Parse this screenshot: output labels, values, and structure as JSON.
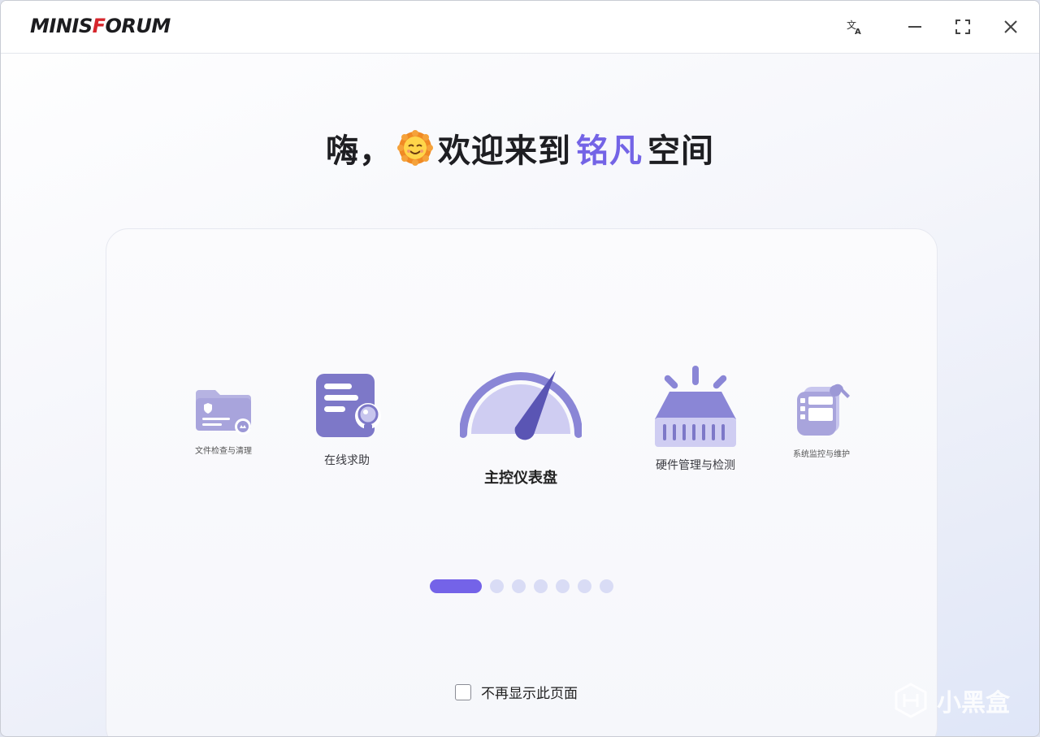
{
  "titlebar": {
    "logo_text_1": "MINIS",
    "logo_text_2": "F",
    "logo_text_3": "ORUM",
    "icons": [
      "translate-icon",
      "minimize-icon",
      "maximize-icon",
      "close-icon"
    ]
  },
  "welcome": {
    "prefix": "嗨，",
    "emoji": "smiling-sun-icon",
    "middle": "欢迎来到",
    "brand": "铭凡",
    "suffix": "空间"
  },
  "carousel": {
    "features": [
      {
        "label": "文件检查与清理",
        "icon": "folder-shield-icon"
      },
      {
        "label": "在线求助",
        "icon": "help-document-icon"
      },
      {
        "label": "主控仪表盘",
        "icon": "dashboard-gauge-icon"
      },
      {
        "label": "硬件管理与检测",
        "icon": "hardware-chip-icon"
      },
      {
        "label": "系统监控与维护",
        "icon": "system-maintenance-icon"
      }
    ],
    "page_count": 7,
    "active_page": 1
  },
  "dont_show": {
    "label": "不再显示此页面",
    "checked": false
  },
  "watermark": {
    "text": "小黑盒"
  },
  "colors": {
    "accent": "#7464e6",
    "icon_primary": "#8a86cf",
    "icon_light": "#c8c6ee",
    "logo_red": "#d6262c"
  }
}
